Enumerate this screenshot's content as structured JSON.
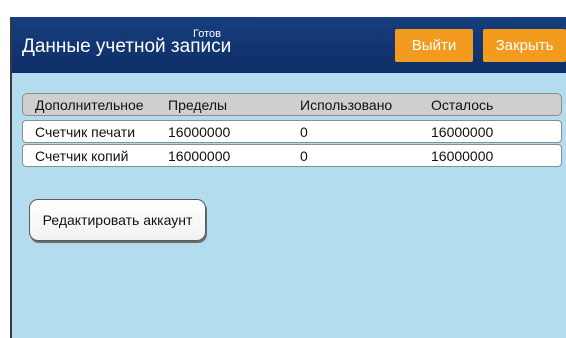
{
  "header": {
    "title": "Данные учетной записи",
    "status": "Готов",
    "logout_label": "Выйти",
    "close_label": "Закрыть",
    "accent_color": "#F29B1E",
    "bar_color": "#173E7F"
  },
  "table": {
    "columns": [
      "Дополнительное",
      "Пределы",
      "Использовано",
      "Осталось"
    ],
    "rows": [
      [
        "Счетчик печати",
        "16000000",
        "0",
        "16000000"
      ],
      [
        "Счетчик копий",
        "16000000",
        "0",
        "16000000"
      ]
    ]
  },
  "edit_button_label": "Редактировать аккаунт"
}
